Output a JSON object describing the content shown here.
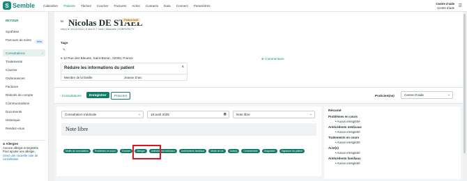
{
  "app": {
    "name": "Semble"
  },
  "nav": [
    "Calendrier",
    "Patients",
    "Tâches",
    "Courrier",
    "Factures",
    "Actes",
    "Contacts",
    "Data",
    "Connect",
    "Paramètres"
  ],
  "nav_active": "Patients",
  "account": {
    "line1": "Centre d'aide",
    "line2": "Centre d'aide"
  },
  "sidebar": {
    "back": "RETOUR",
    "items": [
      "Synthèse",
      "Parcours de soins",
      "Consultations",
      "Traitements",
      "Courrier",
      "Ordonnances",
      "Factures",
      "Relevés de compte",
      "Communications",
      "Documents",
      "Historique",
      "Rendez-vous"
    ],
    "beta": "bêta",
    "allergy_title": "Allergies",
    "allergy_none": "Aucune allergie enregistrée",
    "allergy_add": "Pour ajouter une allergie,",
    "allergy_link": "créez une nouvelle note de consultation"
  },
  "patient": {
    "title": "M. ",
    "name": "Nicolas DE STAEL",
    "badge": "Patient Actif",
    "meta": "né(e) le 10/12/2016  |  8 ans et 7 mois  |  Masculin  |  KZBRVDKTY",
    "tags_label": "Tags",
    "address": "12 Rue des Bleuets, Saint-Brieuc, 22000, France",
    "comment": "Commentaire"
  },
  "reduce": {
    "title": "Réduire les informations du patient",
    "row_label": "Membre de la famille",
    "row_value": "Jeanne D'arc"
  },
  "toolbar": {
    "consultations": "Consultations",
    "save": "Enregistrer",
    "print": "Prescrire",
    "prat_label": "Praticien(ne)",
    "prat_value": "Centre D'aide"
  },
  "editor": {
    "type": "Consultation médicale",
    "date": "18 août 2025",
    "template": "Note libre",
    "heading": "Note libre",
    "chips": [
      "Motifs de consultation",
      "Problèmes en cours",
      "Examen",
      "Allergie",
      "Antécédents médicaux",
      "Antécédents familiaux",
      "Mode de vie",
      "Acte(s)",
      "Commentaire",
      "Diagnostic",
      "Signature du patient"
    ]
  },
  "resume": {
    "title": "Résumé",
    "sections": [
      {
        "label": "Problèmes en cours",
        "value": "Aucun enregistré"
      },
      {
        "label": "Antécédents médicaux",
        "value": "Aucun enregistré"
      },
      {
        "label": "Traitements en cours",
        "value": "Aucun enregistré"
      },
      {
        "label": "Acte(s)",
        "value": "Aucun enregistré"
      },
      {
        "label": "Antécédents familiaux",
        "value": "Aucun enregistré"
      }
    ]
  },
  "colors": {
    "brand": "#1a8c78",
    "highlight": "#e0151b"
  }
}
